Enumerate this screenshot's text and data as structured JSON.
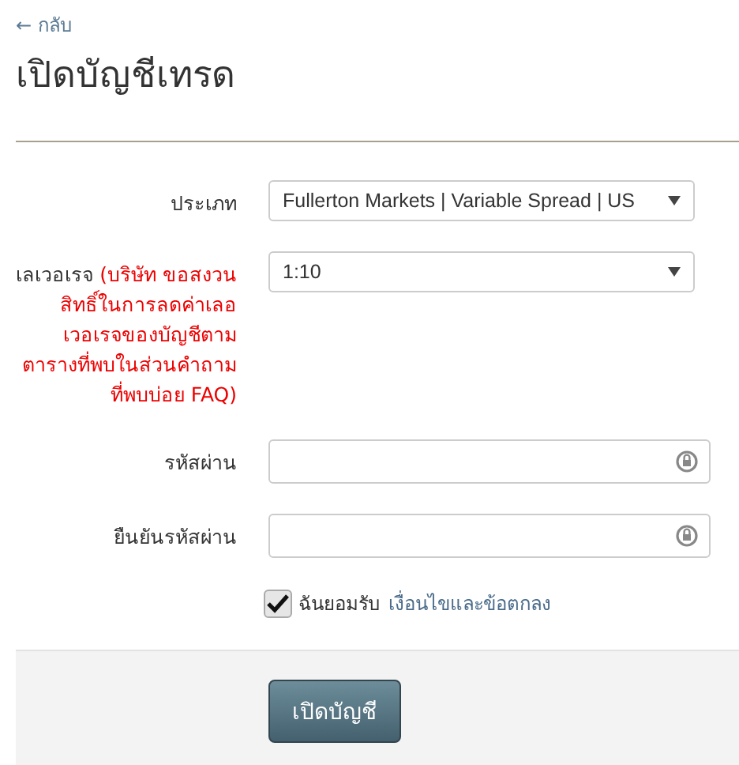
{
  "back_link": "← กลับ",
  "title": "เปิดบัญชีเทรด",
  "fields": [
    {
      "kind": "select",
      "label": "ประเภท",
      "value": "Fullerton Markets | Variable Spread | US"
    },
    {
      "kind": "select",
      "label": "เลเวอเรจ",
      "note": "(บริษัท ขอสงวนสิทธิ์ในการลดค่าเลอเวอเรจของบัญชีตามตารางที่พบในส่วนคำถามที่พบบ่อย FAQ)",
      "value": "1:10"
    },
    {
      "kind": "password",
      "label": "รหัสผ่าน"
    },
    {
      "kind": "password",
      "label": "ยืนยันรหัสผ่าน"
    }
  ],
  "agree": {
    "checked": true,
    "text": "ฉันยอมรับ",
    "link": "เงื่อนไขและข้อตกลง"
  },
  "submit": "เปิดบัญชี"
}
